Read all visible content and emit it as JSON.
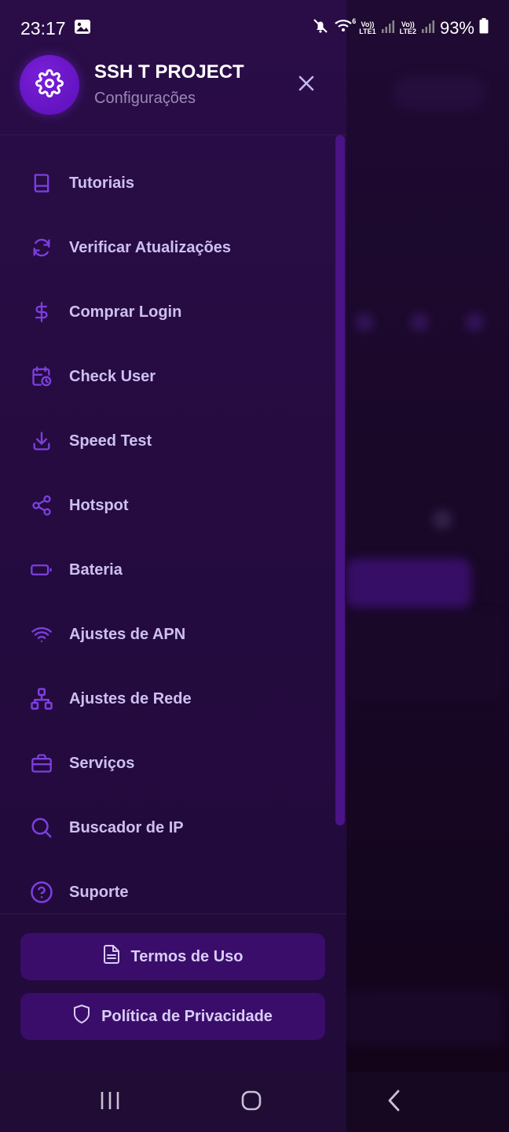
{
  "status_bar": {
    "time": "23:17",
    "sim1_label_top": "Vo))",
    "sim1_label_bottom": "LTE1",
    "sim2_label_top": "Vo))",
    "sim2_label_bottom": "LTE2",
    "wifi_badge": "6",
    "battery": "93%"
  },
  "drawer": {
    "title": "SSH T PROJECT",
    "subtitle": "Configurações",
    "items": [
      {
        "label": "Tutoriais",
        "icon": "book-icon"
      },
      {
        "label": "Verificar Atualizações",
        "icon": "refresh-icon"
      },
      {
        "label": "Comprar Login",
        "icon": "dollar-icon"
      },
      {
        "label": "Check User",
        "icon": "calendar-clock-icon"
      },
      {
        "label": "Speed Test",
        "icon": "download-icon"
      },
      {
        "label": "Hotspot",
        "icon": "share-icon"
      },
      {
        "label": "Bateria",
        "icon": "battery-icon"
      },
      {
        "label": "Ajustes de APN",
        "icon": "wifi-icon"
      },
      {
        "label": "Ajustes de Rede",
        "icon": "network-icon"
      },
      {
        "label": "Serviços",
        "icon": "briefcase-icon"
      },
      {
        "label": "Buscador de IP",
        "icon": "search-icon"
      },
      {
        "label": "Suporte",
        "icon": "help-icon"
      }
    ],
    "footer": {
      "terms_label": "Termos de Uso",
      "privacy_label": "Política de Privacidade"
    }
  },
  "colors": {
    "accent": "#7a1fd8",
    "icon": "#7d3fe0",
    "drawer_bg": "#250b40"
  }
}
